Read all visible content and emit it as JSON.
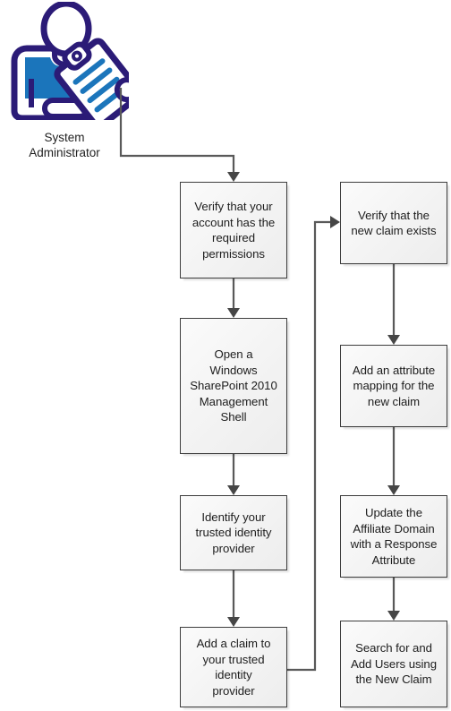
{
  "diagram": {
    "title": "System Administrator claim configuration workflow",
    "type": "flowchart",
    "background_color": "#ffffff",
    "node_fill_color": "#f3f3f3",
    "node_border_color": "#3d3d3d",
    "connector_color": "#595959",
    "icon_primary_color": "#2b1b77",
    "icon_accent_color": "#1b75bb"
  },
  "actor": {
    "icon": "system-administrator-icon",
    "label": "System\nAdministrator"
  },
  "nodes": [
    {
      "id": "verify-permissions",
      "label": "Verify that your\naccount has the\nrequired\npermissions",
      "column": "left",
      "order": 1
    },
    {
      "id": "open-management-shell",
      "label": "Open a\nWindows\nSharePoint 2010\nManagement\nShell",
      "column": "left",
      "order": 2
    },
    {
      "id": "identify-trusted-identity-provider",
      "label": "Identify your\ntrusted identity\nprovider",
      "column": "left",
      "order": 3
    },
    {
      "id": "add-claim-to-provider",
      "label": "Add a claim to\nyour trusted\nidentity\nprovider",
      "column": "left",
      "order": 4
    },
    {
      "id": "verify-new-claim-exists",
      "label": "Verify that the\nnew claim exists",
      "column": "right",
      "order": 5
    },
    {
      "id": "add-attribute-mapping",
      "label": "Add an attribute\nmapping for the\nnew claim",
      "column": "right",
      "order": 6
    },
    {
      "id": "update-affiliate-domain",
      "label": "Update the\nAffiliate Domain\nwith a Response\nAttribute",
      "column": "right",
      "order": 7
    },
    {
      "id": "search-add-users",
      "label": "Search for and\nAdd Users using\nthe New Claim",
      "column": "right",
      "order": 8
    }
  ],
  "connectors": [
    {
      "id": "actor-to-verify-permissions",
      "from": "actor",
      "to": "verify-permissions"
    },
    {
      "id": "verify-permissions-to-shell",
      "from": "verify-permissions",
      "to": "open-management-shell"
    },
    {
      "id": "shell-to-identify-provider",
      "from": "open-management-shell",
      "to": "identify-trusted-identity-provider"
    },
    {
      "id": "identify-provider-to-add-claim",
      "from": "identify-trusted-identity-provider",
      "to": "add-claim-to-provider"
    },
    {
      "id": "add-claim-to-verify-claim",
      "from": "add-claim-to-provider",
      "to": "verify-new-claim-exists"
    },
    {
      "id": "verify-claim-to-attribute-mapping",
      "from": "verify-new-claim-exists",
      "to": "add-attribute-mapping"
    },
    {
      "id": "attribute-mapping-to-affiliate-domain",
      "from": "add-attribute-mapping",
      "to": "update-affiliate-domain"
    },
    {
      "id": "affiliate-domain-to-search-users",
      "from": "update-affiliate-domain",
      "to": "search-add-users"
    }
  ]
}
